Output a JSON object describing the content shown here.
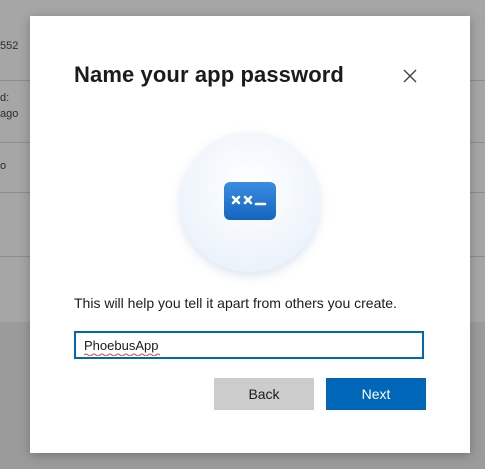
{
  "background": {
    "rows": [
      {
        "text": "552"
      },
      {
        "text": "d:"
      },
      {
        "text": "ago"
      },
      {
        "text": "o"
      }
    ]
  },
  "dialog": {
    "title": "Name your app password",
    "close_icon": "close-icon",
    "illustration_icon": "app-password-key-icon",
    "description": "This will help you tell it apart from others you create.",
    "input": {
      "value": "PhoebusApp",
      "placeholder": ""
    },
    "buttons": {
      "back_label": "Back",
      "next_label": "Next"
    }
  },
  "colors": {
    "accent": "#0067b8",
    "secondary_button": "#cccccc",
    "overlay": "#7f7f7f"
  }
}
